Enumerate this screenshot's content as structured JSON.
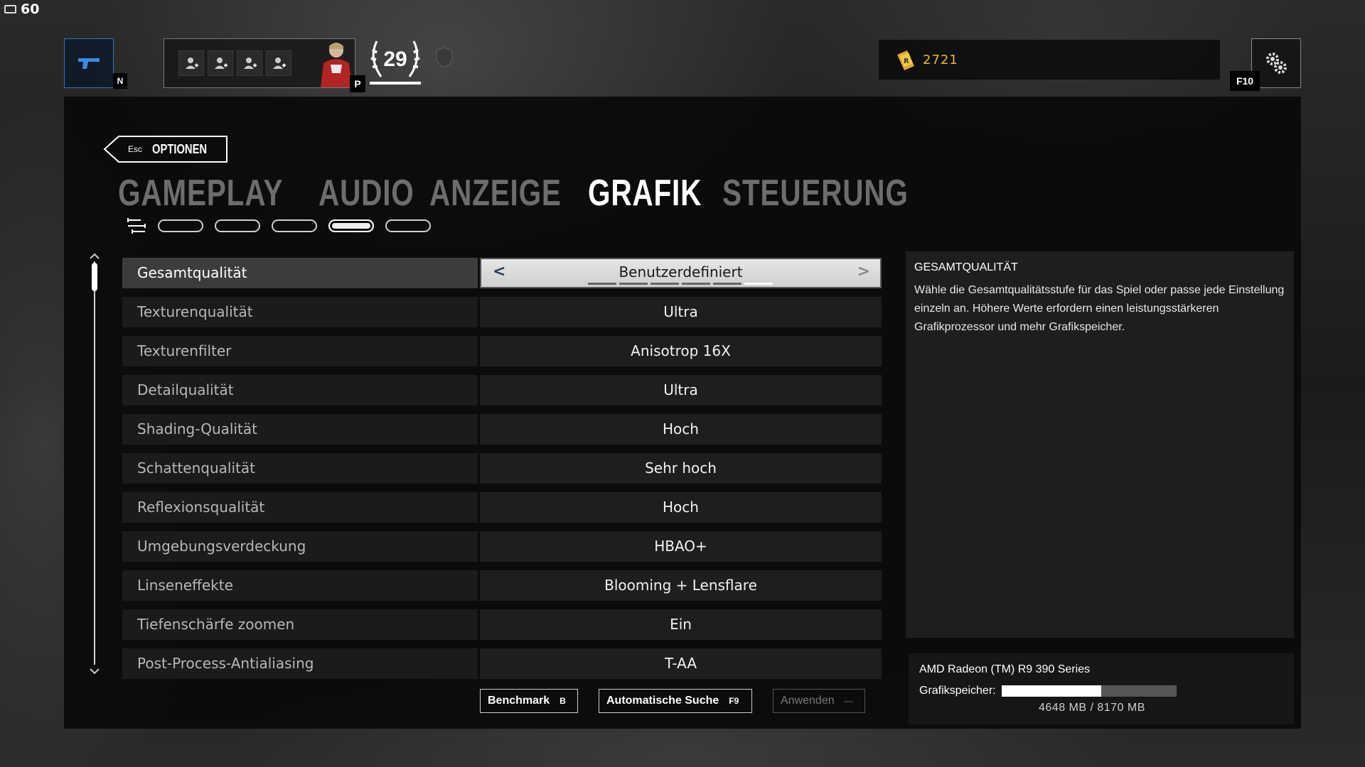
{
  "hud": {
    "fps": "60",
    "weapon_key": "N",
    "squad_key": "P",
    "level": "29",
    "level_progress": 1.0,
    "currency": "2721",
    "settings_key": "F10"
  },
  "header": {
    "back_key": "Esc",
    "back_label": "OPTIONEN"
  },
  "tabs": [
    {
      "label": "GAMEPLAY",
      "active": false
    },
    {
      "label": "AUDIO",
      "active": false
    },
    {
      "label": "ANZEIGE",
      "active": false
    },
    {
      "label": "GRAFIK",
      "active": true
    },
    {
      "label": "STEUERUNG",
      "active": false
    }
  ],
  "subnav": {
    "count": 5,
    "active_index": 3
  },
  "settings": [
    {
      "label": "Gesamtqualität",
      "value": "Benutzerdefiniert",
      "selected": true
    },
    {
      "label": "Texturenqualität",
      "value": "Ultra"
    },
    {
      "label": "Texturenfilter",
      "value": "Anisotrop 16X"
    },
    {
      "label": "Detailqualität",
      "value": "Ultra"
    },
    {
      "label": "Shading-Qualität",
      "value": "Hoch"
    },
    {
      "label": "Schattenqualität",
      "value": "Sehr hoch"
    },
    {
      "label": "Reflexionsqualität",
      "value": "Hoch"
    },
    {
      "label": "Umgebungsverdeckung",
      "value": "HBAO+"
    },
    {
      "label": "Linseneffekte",
      "value": "Blooming + Lensflare"
    },
    {
      "label": "Tiefenschärfe zoomen",
      "value": "Ein"
    },
    {
      "label": "Post-Process-Antialiasing",
      "value": "T-AA"
    }
  ],
  "quality_steps": {
    "total": 6,
    "active": 5
  },
  "buttons": {
    "benchmark": {
      "label": "Benchmark",
      "key": "B"
    },
    "auto_detect": {
      "label": "Automatische Suche",
      "key": "F9"
    },
    "apply": {
      "label": "Anwenden",
      "key": "—"
    }
  },
  "description": {
    "title": "GESAMTQUALITÄT",
    "text": "Wähle die Gesamtqualitätsstufe für das Spiel oder passe jede Einstellung einzeln an. Höhere Werte erfordern einen leistungsstärkeren Grafikprozessor und mehr Grafikspeicher."
  },
  "gpu": {
    "name": "AMD Radeon (TM) R9 390 Series",
    "memory_label": "Grafikspeicher:",
    "memory_used_mb": 4648,
    "memory_total_mb": 8170,
    "memory_text": "4648 MB / 8170 MB"
  },
  "colors": {
    "accent_blue": "#3a73b8",
    "currency_gold": "#e8b93a"
  },
  "icons": [
    "monitor-icon",
    "pistol-icon",
    "add-player-icon",
    "laurel-icon",
    "shield-icon",
    "renown-icon",
    "gear-icon",
    "filter-icon",
    "chevron-left-icon",
    "chevron-right-icon",
    "scroll-up-icon",
    "scroll-down-icon"
  ]
}
